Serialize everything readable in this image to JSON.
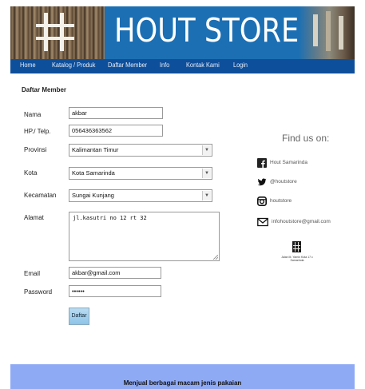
{
  "header": {
    "title": "HOUT STORE",
    "brand_color": "#1c6fb3"
  },
  "nav": {
    "items": [
      "Home",
      "Katalog / Produk",
      "Daftar Member",
      "Info",
      "Kontak Kami",
      "Login"
    ],
    "color": "#0e4f9b"
  },
  "form": {
    "title": "Daftar Member",
    "nama": {
      "label": "Nama",
      "value": "akbar"
    },
    "hp": {
      "label": "HP./ Telp.",
      "value": "056436363562"
    },
    "provinsi": {
      "label": "Provinsi",
      "value": "Kalimantan Timur"
    },
    "kota": {
      "label": "Kota",
      "value": "Kota Samarinda"
    },
    "kecamatan": {
      "label": "Kecamatan",
      "value": "Sungai Kunjang"
    },
    "alamat": {
      "label": "Alamat",
      "value": "jl.kasutri no 12 rt 32"
    },
    "email": {
      "label": "Email",
      "value": "akbar@gmail.com"
    },
    "password": {
      "label": "Password",
      "value": "••••••"
    },
    "submit_label": "Daftar"
  },
  "social": {
    "heading": "Find us on:",
    "items": [
      {
        "icon": "facebook-icon",
        "text": "Hout Samarinda"
      },
      {
        "icon": "twitter-icon",
        "text": "@houtstore"
      },
      {
        "icon": "instagram-icon",
        "text": "houtstore"
      },
      {
        "icon": "email-icon",
        "text": "infohoutstore@gmail.com"
      }
    ],
    "address": "Jalan M. Yamin Kota 17 c Samarinda"
  },
  "footer": {
    "text": "Menjual berbagai macam jenis pakaian",
    "color": "#8faaf5"
  }
}
